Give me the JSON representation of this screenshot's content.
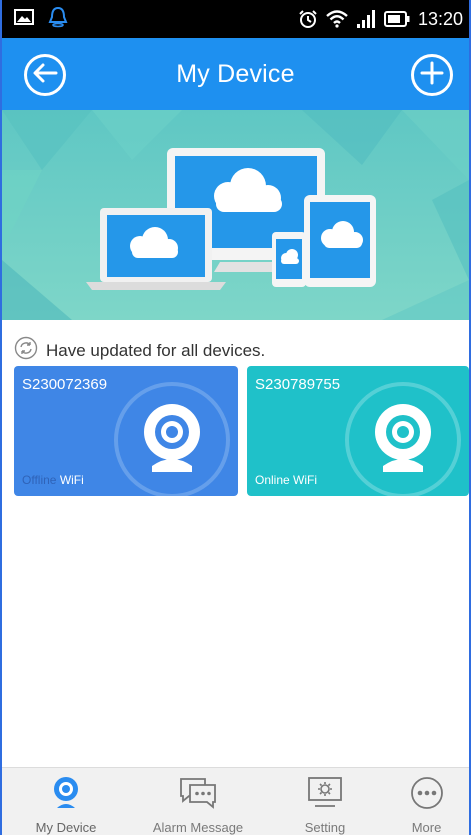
{
  "status_bar": {
    "time": "13:20",
    "left_icons": [
      "image-icon",
      "qq-bell-icon"
    ],
    "right_icons": [
      "alarm-clock-icon",
      "wifi-icon",
      "signal-icon",
      "battery-icon"
    ]
  },
  "header": {
    "title": "My Device",
    "back_icon": "back-arrow-icon",
    "add_icon": "plus-icon",
    "color": "#1e90f0"
  },
  "update_message": "Have updated for all devices.",
  "devices": [
    {
      "id": "S230072369",
      "status": "Offline",
      "network": "WiFi",
      "color": "#3f86e6"
    },
    {
      "id": "S230789755",
      "status": "Online",
      "network": "WiFi",
      "color": "#1fc1c9"
    }
  ],
  "tabbar": {
    "items": [
      {
        "label": "My Device",
        "icon": "webcam-icon",
        "active": true
      },
      {
        "label": "Alarm Message",
        "icon": "chat-bubble-icon",
        "active": false
      },
      {
        "label": "Setting",
        "icon": "monitor-gear-icon",
        "active": false
      },
      {
        "label": "More",
        "icon": "more-dots-icon",
        "active": false
      }
    ]
  }
}
